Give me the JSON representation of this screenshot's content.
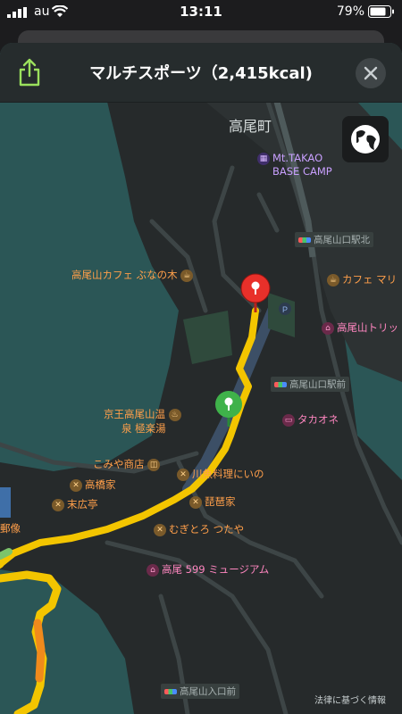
{
  "status_bar": {
    "carrier": "au",
    "time": "13:11",
    "battery": "79%"
  },
  "header": {
    "title": "マルチスポーツ（2,415kcal)",
    "share_icon": "share-icon",
    "close_icon": "close-icon"
  },
  "map": {
    "globe_icon": "globe-icon",
    "area_label": "高尾町",
    "pois": [
      {
        "label": "Mt.TAKAO",
        "label2": "BASE CAMP"
      },
      {
        "label": "高尾山カフェ ぶなの木"
      },
      {
        "label": "カフェ マリ"
      },
      {
        "label": "高尾山トリッ"
      },
      {
        "label": "京王高尾山温",
        "label2": "泉 極楽湯"
      },
      {
        "label": "タカオネ"
      },
      {
        "label": "こみや商店"
      },
      {
        "label": "川魚料理にいの"
      },
      {
        "label": "高橋家"
      },
      {
        "label": "琵琶家"
      },
      {
        "label": "末広亭"
      },
      {
        "label": "むぎとろ つたや"
      },
      {
        "label": "高尾 599 ミュージアム"
      },
      {
        "label": "郵像"
      }
    ],
    "stations": [
      "高尾山口駅北",
      "高尾山口駅前",
      "高尾山入口前"
    ],
    "legal": "法律に基づく情報"
  },
  "colors": {
    "route_yellow": "#f3c500",
    "route_orange": "#f08a1c",
    "water": "#2b5656",
    "land": "#262a2b",
    "end_pin": "#e8302a",
    "start_pin": "#3fb24a"
  }
}
